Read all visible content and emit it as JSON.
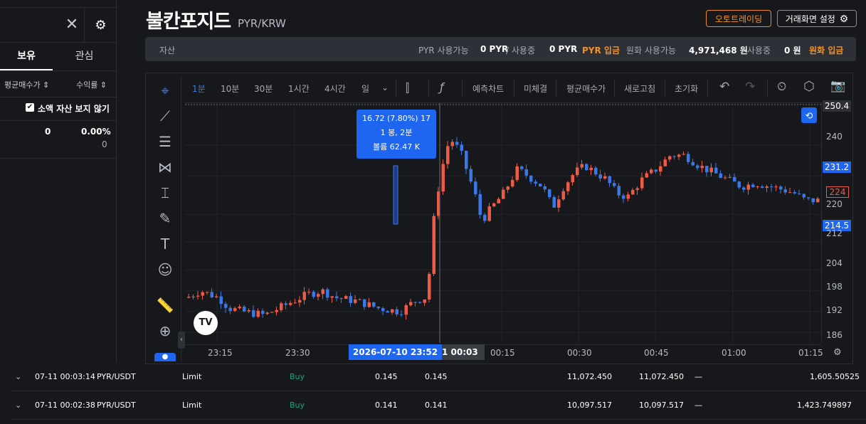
{
  "left_panel": {
    "tabs": [
      "보유",
      "관심"
    ],
    "sort_avg_price": "평균매수가 ⇕",
    "sort_return": "수익률 ⇕",
    "hide_small_label": "소액 자산 보지 않기",
    "row": {
      "value": "0",
      "percent": "0.00%",
      "sub": "0"
    }
  },
  "header": {
    "title": "불칸포지드",
    "pair": "PYR/KRW",
    "auto_trading": "오토트레이딩",
    "screen_settings": "거래화면 설정"
  },
  "asset_bar": {
    "label": "자산",
    "pyr_available_label": "PYR 사용가능",
    "pyr_available": "0 PYR",
    "slash_in_use1": "/ 사용중",
    "pyr_in_use": "0 PYR",
    "pyr_deposit": "PYR 입금",
    "krw_available_label": "원화 사용가능",
    "krw_available": "4,971,468 원",
    "slash_in_use2": "/ 사용중",
    "krw_in_use": "0 원",
    "krw_deposit": "원화 입금"
  },
  "toolbar": {
    "intervals": [
      "1분",
      "10분",
      "30분",
      "1시간",
      "4시간",
      "일"
    ],
    "items": [
      "예측차트",
      "미체결",
      "평균매수가",
      "새로고침",
      "초기화"
    ]
  },
  "chart_data": {
    "type": "candlestick",
    "price_labels": [
      "250.4",
      "240",
      "231.2",
      "224",
      "220",
      "214.5",
      "212",
      "204",
      "198",
      "192",
      "186"
    ],
    "time_labels": [
      "23:15",
      "23:30",
      "00:15",
      "00:30",
      "00:45",
      "01:00",
      "01:15"
    ],
    "tooltip": {
      "line1": "16.72 (7.80%) 17",
      "line2": "1 봉, 2분",
      "line3": "볼륨 62.47 K"
    },
    "crosshair_date": "2026-07-10  23:52",
    "crosshair_time2": "1  00:03",
    "ylim": [
      183,
      252
    ],
    "colors": {
      "up": "#ef5a44",
      "down": "#3b78e7"
    }
  },
  "orders": [
    {
      "time": "07-11 00:03:14",
      "symbol": "PYR/USDT",
      "type": "Limit",
      "side": "Buy",
      "p1": "0.145",
      "p2": "0.145",
      "a1": "11,072.450",
      "a2": "11,072.450",
      "dash": "—",
      "total": "1,605.50525"
    },
    {
      "time": "07-11 00:02:38",
      "symbol": "PYR/USDT",
      "type": "Limit",
      "side": "Buy",
      "p1": "0.141",
      "p2": "0.141",
      "a1": "10,097.517",
      "a2": "10,097.517",
      "dash": "—",
      "total": "1,423.749897"
    }
  ]
}
